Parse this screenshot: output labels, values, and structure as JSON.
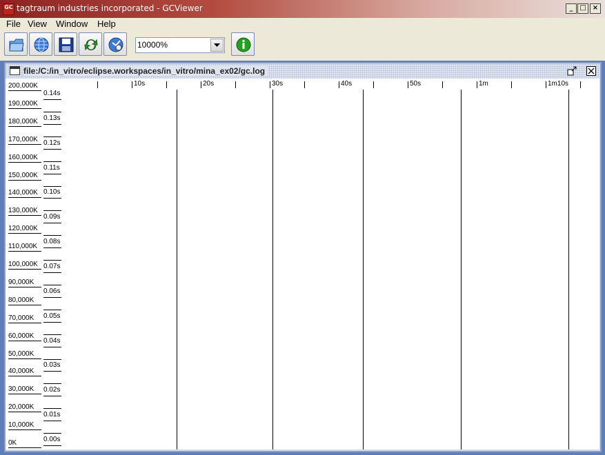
{
  "window": {
    "title": "tagtraum industries incorporated - GCViewer",
    "icon_text": "GC",
    "minimize_icon": "_",
    "maximize_icon": "□",
    "close_icon": "×"
  },
  "menu": [
    "File",
    "View",
    "Window",
    "Help"
  ],
  "toolbar": {
    "buttons": [
      "open-icon",
      "open-url-icon",
      "save-icon",
      "refresh-icon",
      "watch-icon",
      "info-icon"
    ],
    "zoom": {
      "value": "10000%"
    }
  },
  "document": {
    "file_label": "file:/C:/in_vitro/eclipse.workspaces/in_vitro/mina_ex02/gc.log"
  },
  "chart_data": {
    "type": "line",
    "memory_axis": {
      "labels": [
        "200,000K",
        "190,000K",
        "180,000K",
        "170,000K",
        "160,000K",
        "150,000K",
        "140,000K",
        "130,000K",
        "120,000K",
        "110,000K",
        "100,000K",
        "90,000K",
        "80,000K",
        "70,000K",
        "60,000K",
        "50,000K",
        "40,000K",
        "30,000K",
        "20,000K",
        "10,000K",
        "0K"
      ]
    },
    "pause_axis": {
      "labels": [
        "0.14s",
        "0.13s",
        "0.12s",
        "0.11s",
        "0.10s",
        "0.09s",
        "0.08s",
        "0.07s",
        "0.06s",
        "0.05s",
        "0.04s",
        "0.03s",
        "0.02s",
        "0.01s",
        "0.00s"
      ]
    },
    "time_axis": {
      "labels": [
        "10s",
        "20s",
        "30s",
        "40s",
        "50s",
        "1m",
        "1m10s"
      ],
      "label_seconds": [
        10,
        20,
        30,
        40,
        50,
        60,
        70
      ],
      "minor_tick_seconds": [
        5,
        15,
        25,
        35,
        45,
        55,
        65,
        75
      ]
    },
    "full_gc_lines_seconds": [
      16.5,
      30.4,
      43.5,
      57.7,
      73.3
    ]
  }
}
